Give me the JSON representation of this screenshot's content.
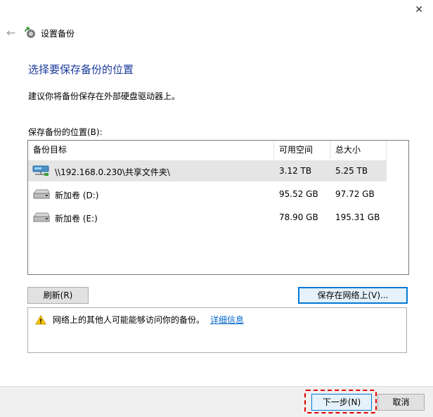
{
  "window": {
    "title": "设置备份",
    "close_glyph": "✕",
    "back_glyph": "←"
  },
  "page": {
    "heading": "选择要保存备份的位置",
    "subtitle": "建议你将备份保存在外部硬盘驱动器上。"
  },
  "list": {
    "label": "保存备份的位置(B):",
    "columns": [
      "备份目标",
      "可用空间",
      "总大小"
    ],
    "rows": [
      {
        "name": "\\\\192.168.0.230\\共享文件夹\\",
        "available": "3.12 TB",
        "total": "5.25 TB",
        "icon": "network-drive-icon",
        "selected": true
      },
      {
        "name": "新加卷 (D:)",
        "available": "95.52 GB",
        "total": "97.72 GB",
        "icon": "hard-drive-icon",
        "selected": false
      },
      {
        "name": "新加卷 (E:)",
        "available": "78.90 GB",
        "total": "195.31 GB",
        "icon": "hard-drive-icon",
        "selected": false
      }
    ]
  },
  "buttons": {
    "refresh": "刷新(R)",
    "save_network": "保存在网络上(V)...",
    "next": "下一步(N)",
    "cancel": "取消"
  },
  "warning": {
    "text": "网络上的其他人可能能够访问你的备份。",
    "link": "详细信息"
  },
  "colors": {
    "heading": "#1b3b9a",
    "link": "#0066cc",
    "highlight": "#e00000",
    "accent": "#0078d7"
  }
}
